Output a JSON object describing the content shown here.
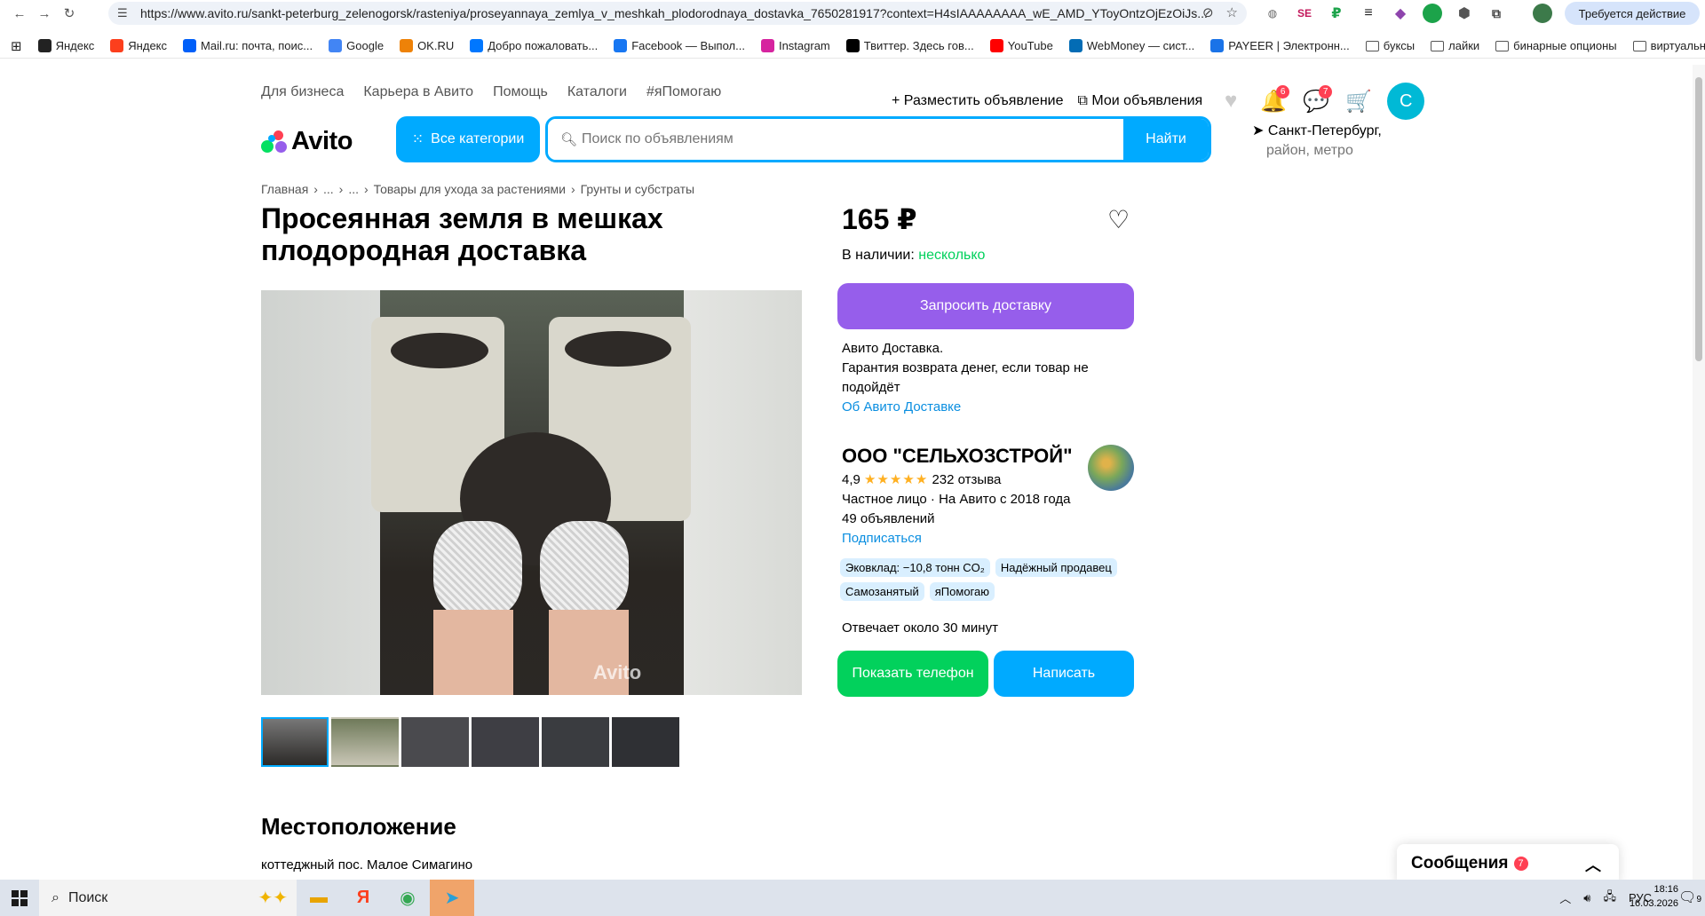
{
  "browser": {
    "url": "https://www.avito.ru/sankt-peterburg_zelenogorsk/rasteniya/proseyannaya_zemlya_v_meshkah_plodorodnaya_dostavka_7650281917?context=H4sIAAAAAAAA_wE_AMD_YToyOntzOjEzOiJs...",
    "action_required": "Требуется действие",
    "bookmarks": [
      {
        "label": "Яндекс",
        "icon": "yandex-plus-icon",
        "color": "#222"
      },
      {
        "label": "Яндекс",
        "icon": "yandex-icon",
        "color": "#fc3f1d"
      },
      {
        "label": "Mail.ru: почта, поис...",
        "icon": "mailru-icon",
        "color": "#005ff9"
      },
      {
        "label": "Google",
        "icon": "google-icon",
        "color": "#4285f4"
      },
      {
        "label": "OK.RU",
        "icon": "ok-icon",
        "color": "#ee8208"
      },
      {
        "label": "Добро пожаловать...",
        "icon": "vk-icon",
        "color": "#0077ff"
      },
      {
        "label": "Facebook — Выпол...",
        "icon": "facebook-icon",
        "color": "#1877f2"
      },
      {
        "label": "Instagram",
        "icon": "instagram-icon",
        "color": "#d6249f"
      },
      {
        "label": "Твиттер. Здесь гов...",
        "icon": "x-icon",
        "color": "#000"
      },
      {
        "label": "YouTube",
        "icon": "youtube-icon",
        "color": "#ff0000"
      },
      {
        "label": "WebMoney — сист...",
        "icon": "webmoney-icon",
        "color": "#036cb5"
      },
      {
        "label": "PAYEER | Электронн...",
        "icon": "payeer-icon",
        "color": "#1a73e8"
      },
      {
        "label": "буксы",
        "icon": "folder-icon",
        "color": ""
      },
      {
        "label": "лайки",
        "icon": "folder-icon",
        "color": ""
      },
      {
        "label": "бинарные опционы",
        "icon": "folder-icon",
        "color": ""
      },
      {
        "label": "виртуально",
        "icon": "folder-icon",
        "color": ""
      }
    ]
  },
  "header": {
    "nav": [
      "Для бизнеса",
      "Карьера в Авито",
      "Помощь",
      "Каталоги",
      "#яПомогаю"
    ],
    "post_ad": "Разместить объявление",
    "my_ads": "Мои объявления",
    "notifications_count": "6",
    "messages_count": "7",
    "avatar_letter": "С",
    "logo": "Avito",
    "all_categories": "Все категории",
    "search_placeholder": "Поиск по объявлениям",
    "search_button": "Найти",
    "location": "Санкт-Петербург,",
    "location_sub": "район, метро"
  },
  "breadcrumb": [
    "Главная",
    "...",
    "...",
    "Товары для ухода за растениями",
    "Грунты и субстраты"
  ],
  "listing": {
    "title": "Просеянная земля в мешках плодородная доставка",
    "price": "165 ₽",
    "stock_label": "В наличии:",
    "stock_value": "несколько",
    "delivery_button": "Запросить доставку",
    "delivery_line1": "Авито Доставка.",
    "delivery_line2": "Гарантия возврата денег, если товар не подойдёт",
    "delivery_link": "Об Авито Доставке",
    "watermark": "Avito"
  },
  "seller": {
    "name": "ООО \"СЕЛЬХОЗСТРОЙ\"",
    "rating": "4,9",
    "stars": "★★★★★",
    "reviews": "232 отзыва",
    "type": "Частное лицо · На Авито с 2018 года",
    "ads_count": "49 объявлений",
    "subscribe": "Подписаться",
    "chips": [
      "Эковклад: −10,8 тонн CO₂",
      "Надёжный продавец",
      "Самозанятый",
      "яПомогаю"
    ],
    "reply_time": "Отвечает около 30 минут",
    "show_phone": "Показать телефон",
    "write": "Написать"
  },
  "location_section": {
    "title": "Местоположение",
    "address": "коттеджный пос. Малое Симагино"
  },
  "messages_widget": {
    "label": "Сообщения",
    "count": "7"
  },
  "taskbar": {
    "search": "Поиск",
    "lang": "РУС",
    "time": "18:16",
    "date": "16.03.2026",
    "notifications": "9"
  }
}
